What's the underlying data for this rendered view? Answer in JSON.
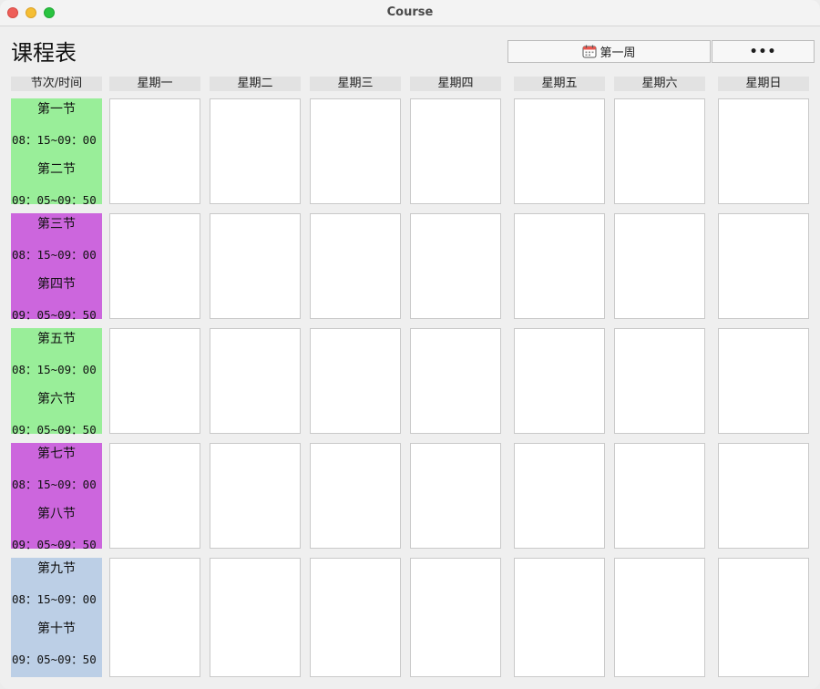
{
  "window": {
    "title": "Course"
  },
  "page": {
    "title": "课程表"
  },
  "toolbar": {
    "week_label": "第一周",
    "more_label": "•••"
  },
  "table": {
    "corner_header": "节次/时间",
    "days": [
      "星期一",
      "星期二",
      "星期三",
      "星期四",
      "星期五",
      "星期六",
      "星期日"
    ],
    "periods": [
      {
        "first_label": "第一节",
        "first_time": "08：15~09：00",
        "second_label": "第二节",
        "second_time": "09：05~09：50",
        "color": "#99ee99"
      },
      {
        "first_label": "第三节",
        "first_time": "08：15~09：00",
        "second_label": "第四节",
        "second_time": "09：05~09：50",
        "color": "#cc66dd"
      },
      {
        "first_label": "第五节",
        "first_time": "08：15~09：00",
        "second_label": "第六节",
        "second_time": "09：05~09：50",
        "color": "#99ee99"
      },
      {
        "first_label": "第七节",
        "first_time": "08：15~09：00",
        "second_label": "第八节",
        "second_time": "09：05~09：50",
        "color": "#cc66dd"
      },
      {
        "first_label": "第九节",
        "first_time": "08：15~09：00",
        "second_label": "第十节",
        "second_time": "09：05~09：50",
        "color": "#bccfe6"
      }
    ]
  },
  "icons": {
    "week_button": "calendar-icon"
  }
}
